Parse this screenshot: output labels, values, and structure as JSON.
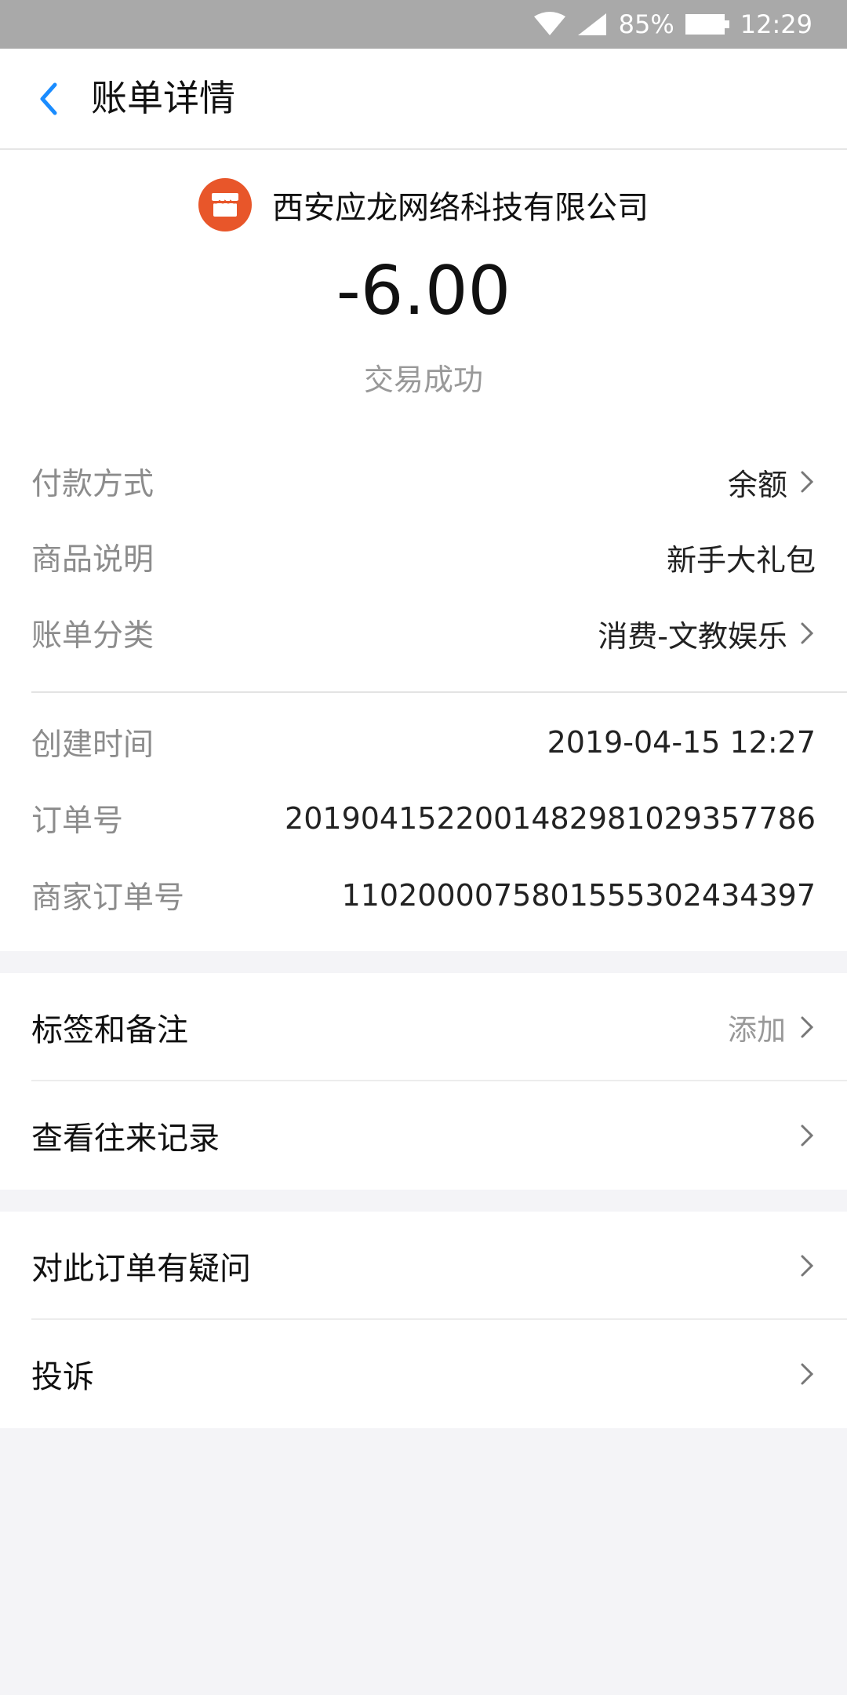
{
  "status_bar": {
    "battery": "85%",
    "time": "12:29"
  },
  "header": {
    "title": "账单详情"
  },
  "merchant": {
    "name": "西安应龙网络科技有限公司"
  },
  "transaction": {
    "amount": "-6.00",
    "status": "交易成功"
  },
  "details": [
    {
      "label": "付款方式",
      "value": "余额",
      "chevron": true
    },
    {
      "label": "商品说明",
      "value": "新手大礼包",
      "chevron": false
    },
    {
      "label": "账单分类",
      "value": "消费-文教娱乐",
      "chevron": true
    },
    {
      "label": "创建时间",
      "value": "2019-04-15 12:27",
      "chevron": false
    },
    {
      "label": "订单号",
      "value": "2019041522001482981029357786",
      "chevron": false
    },
    {
      "label": "商家订单号",
      "value": "1102000075801555302434397",
      "chevron": false
    }
  ],
  "menu1": [
    {
      "label": "标签和备注",
      "action": "添加"
    },
    {
      "label": "查看往来记录"
    }
  ],
  "menu2": [
    {
      "label": "对此订单有疑问"
    },
    {
      "label": "投诉"
    }
  ],
  "colors": {
    "accent": "#1a8cff",
    "merchant_icon": "#e8562a",
    "background": "#f4f4f7"
  }
}
